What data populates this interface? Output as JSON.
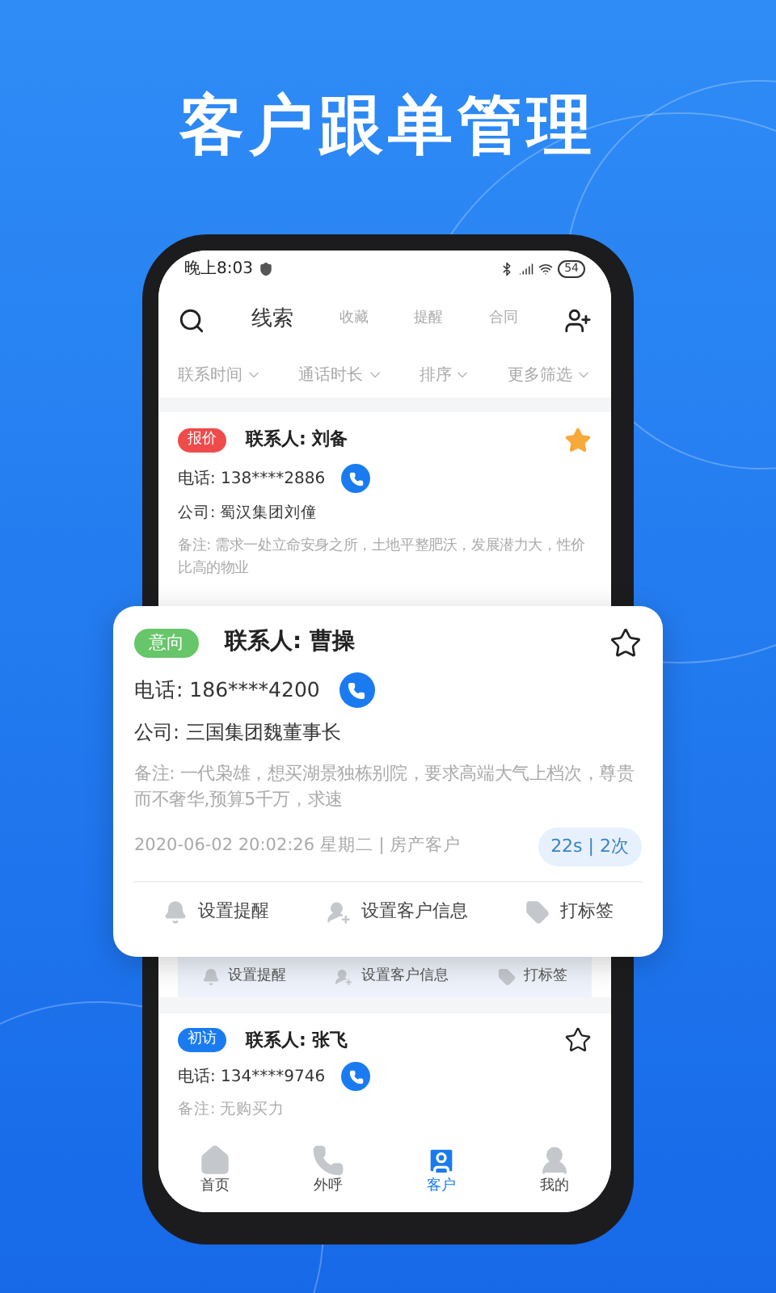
{
  "headline": "客户跟单管理",
  "status_bar": {
    "time": "晚上8:03",
    "battery": "54"
  },
  "tabs": [
    {
      "label": "线索",
      "selected": true
    },
    {
      "label": "收藏",
      "selected": false
    },
    {
      "label": "提醒",
      "selected": false
    },
    {
      "label": "合同",
      "selected": false
    }
  ],
  "filters": [
    "联系时间",
    "通话时长",
    "排序",
    "更多筛选"
  ],
  "customers": [
    {
      "tag": "报价",
      "color": "#ef4b4b",
      "contact": "联系人: 刘备",
      "starred": true,
      "phone": "电话: 138****2886",
      "company": "公司: 蜀汉集团刘僮",
      "note": "备注: 需求一处立命安身之所，土地平整肥沃，发展潜力大，性价比高的物业",
      "actions": [
        {
          "kind": "reminder",
          "label": "设置提醒"
        },
        {
          "kind": "info",
          "label": "设置客户信息"
        },
        {
          "kind": "tag",
          "label": "打标签"
        }
      ]
    },
    {
      "tag": "初访",
      "color": "#1a7bf0",
      "contact": "联系人: 张飞",
      "starred": false,
      "phone": "电话: 134****9746",
      "note": "备注: 无购买力"
    }
  ],
  "popup_card": {
    "tag": "意向",
    "color": "#67c56a",
    "contact": "联系人: 曹操",
    "starred": false,
    "phone": "电话: 186****4200",
    "company": "公司: 三国集团魏董事长",
    "note": "备注: 一代枭雄，想买湖景独栋别院，要求高端大气上档次，尊贵而不奢华,预算5千万，求速",
    "date": "2020-06-02 20:02:26 星期二 | 房产客户",
    "call_stats": "22s | 2次",
    "actions": [
      {
        "kind": "reminder",
        "label": "设置提醒"
      },
      {
        "kind": "info",
        "label": "设置客户信息"
      },
      {
        "kind": "tag",
        "label": "打标签"
      }
    ]
  },
  "bottom_nav": [
    {
      "kind": "home",
      "label": "首页",
      "selected": false
    },
    {
      "kind": "call",
      "label": "外呼",
      "selected": false
    },
    {
      "kind": "customer",
      "label": "客户",
      "selected": true
    },
    {
      "kind": "me",
      "label": "我的",
      "selected": false
    }
  ]
}
